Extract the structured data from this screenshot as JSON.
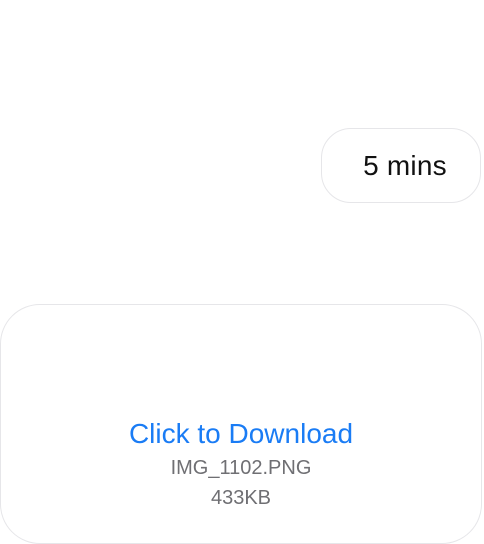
{
  "messages": {
    "time_bubble": {
      "text": "5 mins"
    },
    "attachment": {
      "link_label": "Click to Download",
      "file_name": "IMG_1102.PNG",
      "file_size": "433KB"
    }
  },
  "colors": {
    "link": "#1a7cf5",
    "secondary_text": "#6f6f73",
    "bubble_border": "#e6e6e9"
  }
}
